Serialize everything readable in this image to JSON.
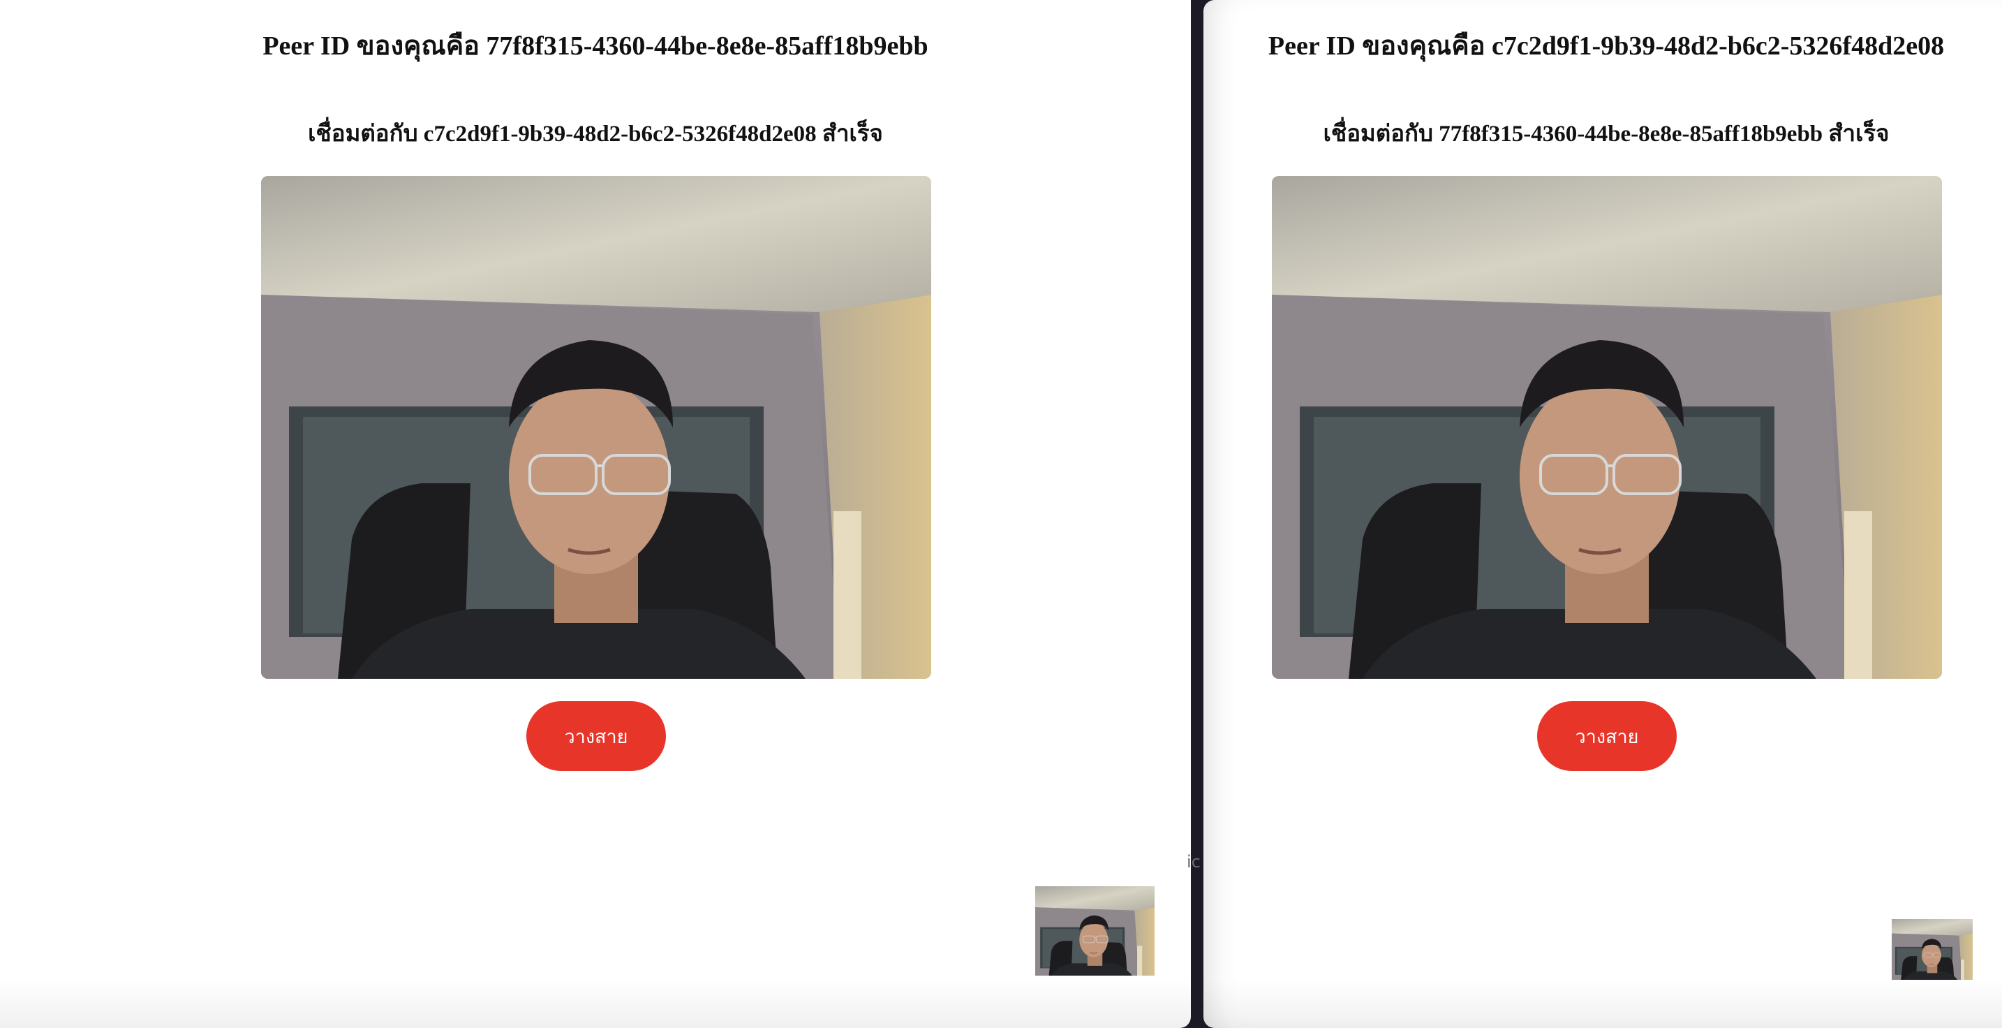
{
  "left_window": {
    "peer_id_heading": "Peer ID ของคุณคือ 77f8f315-4360-44be-8e8e-85aff18b9ebb",
    "connection_status": "เชื่อมต่อกับ c7c2d9f1-9b39-48d2-b6c2-5326f48d2e08 สำเร็จ",
    "hangup_label": "วางสาย"
  },
  "right_window": {
    "peer_id_heading": "Peer ID ของคุณคือ c7c2d9f1-9b39-48d2-b6c2-5326f48d2e08",
    "connection_status": "เชื่อมต่อกับ 77f8f315-4360-44be-8e8e-85aff18b9ebb สำเร็จ",
    "hangup_label": "วางสาย"
  },
  "background_app": {
    "partial_text": "ic"
  },
  "colors": {
    "hangup_button": "#e8352a",
    "page_background": "#ffffff",
    "desktop_background": "#1c1a24"
  }
}
